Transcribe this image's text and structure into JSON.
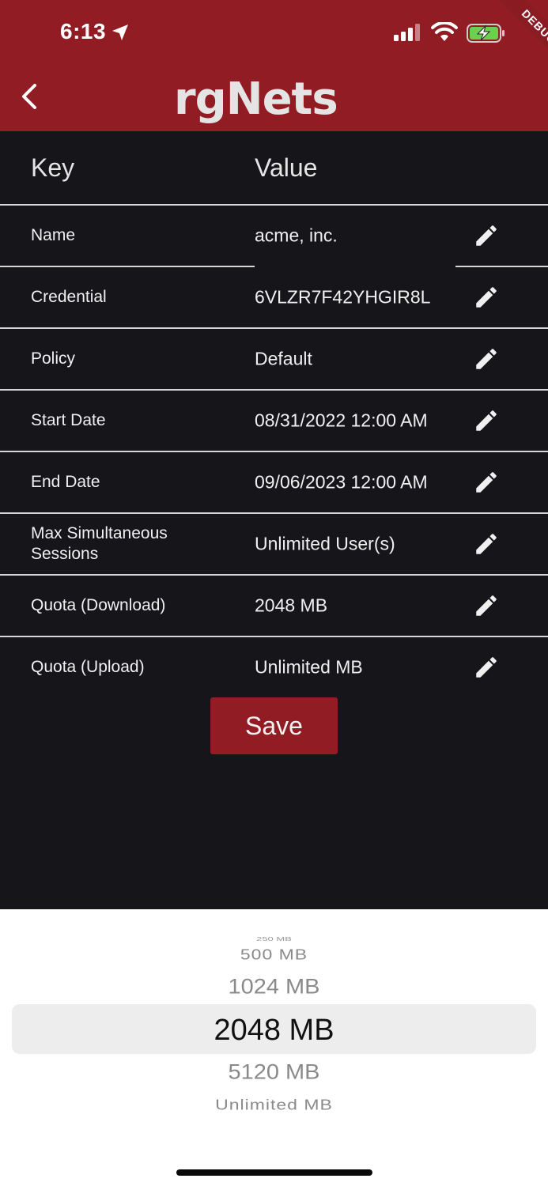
{
  "status_bar": {
    "time": "6:13"
  },
  "debug_banner": "DEBUG",
  "header": {
    "logo_text": "rgNets"
  },
  "table": {
    "key_header": "Key",
    "value_header": "Value",
    "rows": [
      {
        "key": "Name",
        "value": "acme, inc."
      },
      {
        "key": "Credential",
        "value": "6VLZR7F42YHGIR8L"
      },
      {
        "key": "Policy",
        "value": "Default"
      },
      {
        "key": "Start Date",
        "value": "08/31/2022 12:00 AM"
      },
      {
        "key": "End Date",
        "value": "09/06/2023 12:00 AM"
      },
      {
        "key": "Max Simultaneous Sessions",
        "value": "Unlimited User(s)"
      },
      {
        "key": "Quota (Download)",
        "value": "2048 MB"
      },
      {
        "key": "Quota (Upload)",
        "value": "Unlimited MB"
      }
    ]
  },
  "save_label": "Save",
  "picker": {
    "options": [
      "250 MB",
      "500 MB",
      "1024 MB",
      "2048 MB",
      "5120 MB",
      "Unlimited MB"
    ],
    "selected": "2048 MB"
  },
  "colors": {
    "brand": "#921c24",
    "background": "#16151a",
    "text": "#f0f0f0"
  },
  "icons": [
    "back-chevron-icon",
    "location-arrow-icon",
    "signal-icon",
    "wifi-icon",
    "battery-charging-icon",
    "pencil-edit-icon"
  ]
}
